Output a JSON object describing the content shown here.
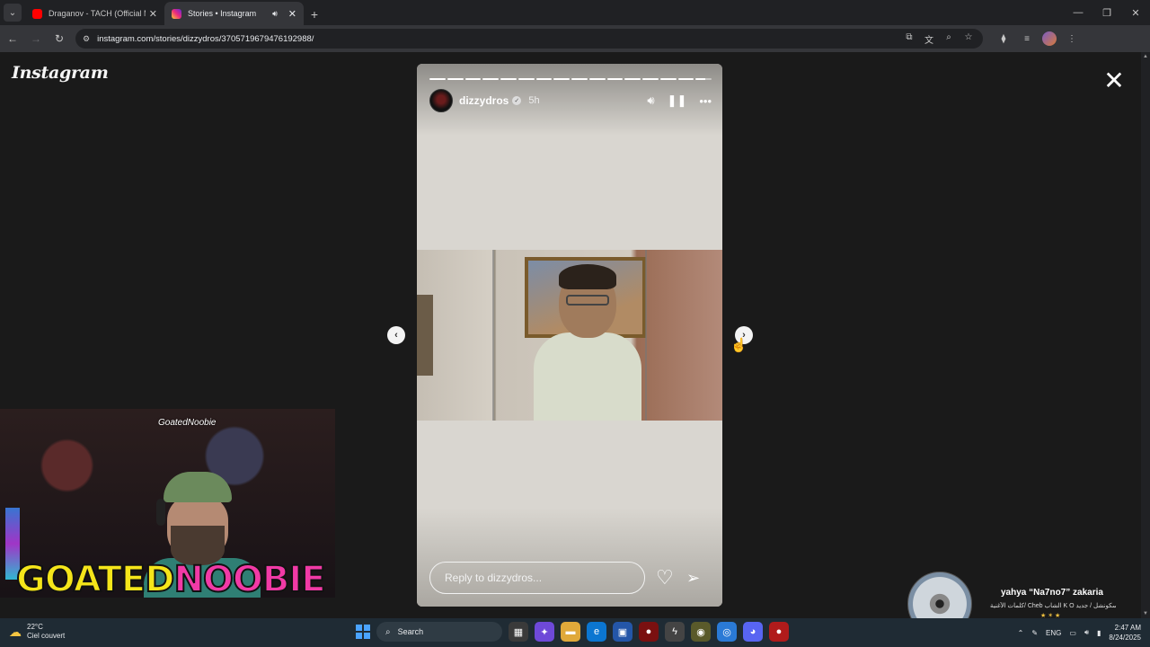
{
  "browser": {
    "tabs": [
      {
        "title": "Draganov - TACH (Official Musi",
        "color": "#ff0000",
        "active": false
      },
      {
        "title": "Stories • Instagram",
        "color": "#d6249f",
        "active": true
      }
    ],
    "url": "instagram.com/stories/dizzydros/3705719679476192988/"
  },
  "page": {
    "logo": "Instagram",
    "story": {
      "username": "dizzydros",
      "time": "5h",
      "reply_placeholder": "Reply to dizzydros...",
      "progress_segments": 16,
      "current_segment": 16
    }
  },
  "webcam": {
    "tag": "GoatedNoobie",
    "brand_part1": "GOATED",
    "brand_part2": "NOOBIE"
  },
  "toast": {
    "title": "yahya “Na7no7” zakaria",
    "subtitle": "كلمات الأغنية/ Cheb الشاب K O سكونشل / جديد",
    "emoji": "★ ✶ ★"
  },
  "taskbar": {
    "weather_temp": "22°C",
    "weather_desc": "Ciel couvert",
    "search_label": "Search",
    "lang": "ENG",
    "time": "2:47 AM",
    "date": "8/24/2025"
  }
}
